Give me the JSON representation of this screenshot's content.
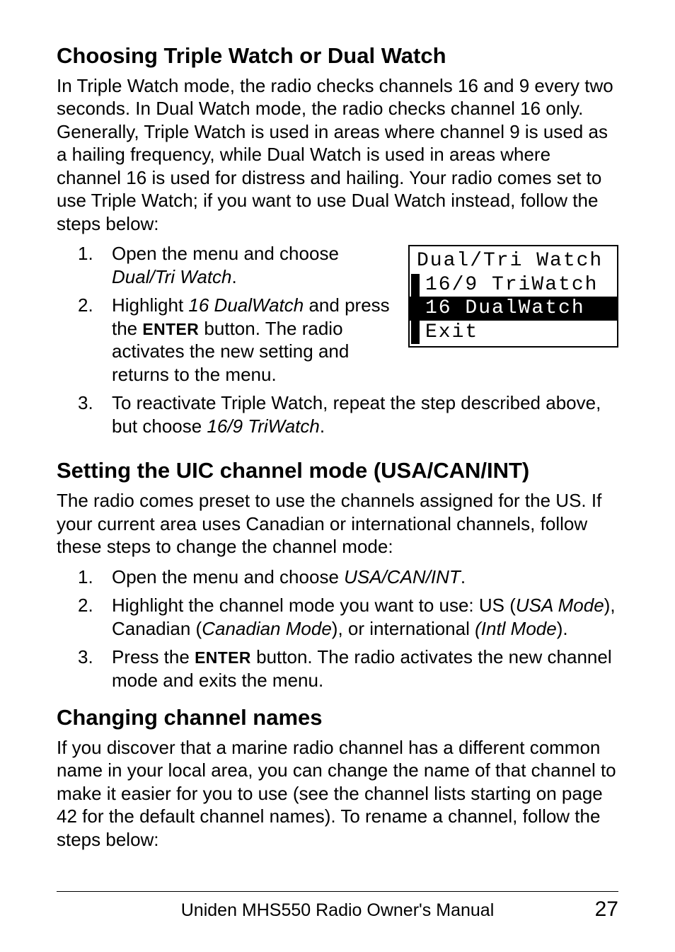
{
  "section1": {
    "heading": "Choosing Triple Watch or Dual Watch",
    "intro": "In Triple Watch mode, the radio checks channels 16 and 9 every two seconds. In Dual Watch mode, the radio checks channel 16 only. Generally, Triple Watch is used in areas where channel 9 is used as a hailing frequency, while Dual Watch is used in areas where channel 16 is used for distress and hailing. Your radio comes set to use Triple Watch; if you want to use Dual Watch instead, follow the steps below:",
    "steps": {
      "s1_num": "1.",
      "s1_a": "Open the menu and choose ",
      "s1_i": "Dual/Tri Watch",
      "s1_b": ".",
      "s2_num": "2.",
      "s2_a": "Highlight ",
      "s2_i": "16 DualWatch",
      "s2_b": " and press the ",
      "s2_enter": "ENTER",
      "s2_c": " button. The radio activates the new setting and returns to the menu.",
      "s3_num": "3.",
      "s3_a": "To reactivate Triple Watch, repeat the step described above, but choose ",
      "s3_i": "16/9 TriWatch",
      "s3_b": "."
    }
  },
  "lcd": {
    "title": "Dual/Tri Watch",
    "opt1": "16/9 TriWatch",
    "opt2": "16 DualWatch",
    "opt3": "Exit"
  },
  "section2": {
    "heading": "Setting the UIC channel mode (USA/CAN/INT)",
    "intro": "The radio comes preset to use the channels assigned for the US. If your current area uses Canadian or international channels, follow these steps to change the channel mode:",
    "steps": {
      "s1_num": "1.",
      "s1_a": "Open the menu and choose ",
      "s1_i": "USA/CAN/INT",
      "s1_b": ".",
      "s2_num": "2.",
      "s2_a": "Highlight the channel mode you want to use: US (",
      "s2_i1": "USA Mode",
      "s2_b": "), Canadian (",
      "s2_i2": "Canadian Mode",
      "s2_c": "), or international ",
      "s2_i3": "(Intl Mode",
      "s2_d": ").",
      "s3_num": "3.",
      "s3_a": "Press the ",
      "s3_enter": "ENTER",
      "s3_b": " button. The radio activates the new channel mode and exits the menu."
    }
  },
  "section3": {
    "heading": "Changing channel names",
    "intro": "If you discover that a marine radio channel has a different common name in your local area, you can change the name of that channel to make it easier for you to use (see the channel lists starting on page 42 for the default channel names). To rename a channel, follow the steps below:"
  },
  "footer": {
    "center": "Uniden MHS550 Radio Owner's Manual",
    "page": "27"
  }
}
